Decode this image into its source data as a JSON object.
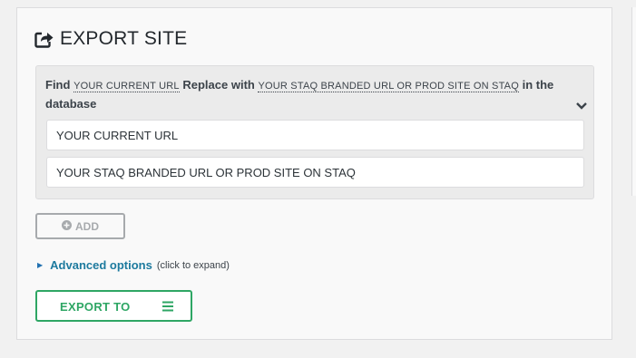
{
  "section": {
    "title": "EXPORT SITE",
    "icon": "export-icon"
  },
  "find_replace": {
    "find_label": "Find",
    "find_placeholder": "YOUR CURRENT URL",
    "replace_label": "Replace with",
    "replace_placeholder": "YOUR STAQ BRANDED URL OR PROD SITE ON STAQ",
    "suffix": "in the database",
    "toggle_icon": "chevron-down-icon",
    "find_value": "YOUR CURRENT URL",
    "replace_value": "YOUR STAQ BRANDED URL OR PROD SITE ON STAQ"
  },
  "add_button": {
    "label": "ADD",
    "icon": "plus-circle-icon"
  },
  "advanced": {
    "link": "Advanced options",
    "hint": "(click to expand)",
    "icon": "triangle-right-icon"
  },
  "export_button": {
    "label": "EXPORT TO",
    "icon": "menu-icon"
  },
  "colors": {
    "accent_green": "#2ea664",
    "link_blue": "#1d7a9e",
    "muted_gray": "#a7aaad"
  }
}
